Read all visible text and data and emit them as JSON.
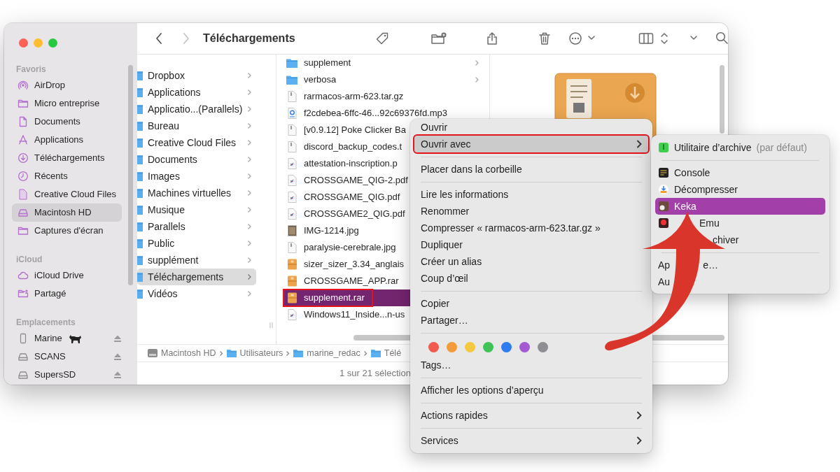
{
  "window": {
    "title": "Téléchargements"
  },
  "navigation": {
    "back_disabled": false,
    "forward_disabled": true
  },
  "sidebar": {
    "sections": [
      {
        "header": "Favoris",
        "items": [
          {
            "label": "AirDrop",
            "selected": false
          },
          {
            "label": "Micro entreprise",
            "selected": false
          },
          {
            "label": "Documents",
            "selected": false
          },
          {
            "label": "Applications",
            "selected": false
          },
          {
            "label": "Téléchargements",
            "selected": false
          },
          {
            "label": "Récents",
            "selected": false
          },
          {
            "label": "Creative Cloud Files",
            "selected": false
          },
          {
            "label": "Macintosh HD",
            "selected": true
          },
          {
            "label": "Captures d'écran",
            "selected": false
          }
        ]
      },
      {
        "header": "iCloud",
        "items": [
          {
            "label": "iCloud Drive",
            "selected": false
          },
          {
            "label": "Partagé",
            "selected": false
          }
        ]
      },
      {
        "header": "Emplacements",
        "items": [
          {
            "label": "Marine",
            "selected": false,
            "ejectable": true
          },
          {
            "label": "SCANS",
            "selected": false,
            "ejectable": true
          },
          {
            "label": "SupersSD",
            "selected": false,
            "ejectable": true
          }
        ]
      }
    ]
  },
  "column_1": [
    {
      "label": "Dropbox",
      "selected": false
    },
    {
      "label": "Applications",
      "selected": false
    },
    {
      "label": "Applicatio...(Parallels)",
      "selected": false
    },
    {
      "label": "Bureau",
      "selected": false
    },
    {
      "label": "Creative Cloud Files",
      "selected": false
    },
    {
      "label": "Documents",
      "selected": false
    },
    {
      "label": "Images",
      "selected": false
    },
    {
      "label": "Machines virtuelles",
      "selected": false
    },
    {
      "label": "Musique",
      "selected": false
    },
    {
      "label": "Parallels",
      "selected": false
    },
    {
      "label": "Public",
      "selected": false
    },
    {
      "label": "supplément",
      "selected": false
    },
    {
      "label": "Téléchargements",
      "selected": true
    },
    {
      "label": "Vidéos",
      "selected": false
    }
  ],
  "column_2": [
    {
      "label": "supplement",
      "kind": "folder",
      "selected": false
    },
    {
      "label": "verbosa",
      "kind": "folder",
      "selected": false
    },
    {
      "label": "rarmacos-arm-623.tar.gz",
      "kind": "document",
      "selected": false
    },
    {
      "label": "f2cdebea-6ffc-46...92c69376fd.mp3",
      "kind": "audio",
      "selected": false
    },
    {
      "label": "[v0.9.12] Poke Clicker Ba",
      "kind": "document",
      "selected": false
    },
    {
      "label": "discord_backup_codes.t",
      "kind": "document",
      "selected": false
    },
    {
      "label": "attestation-inscription.p",
      "kind": "pdf",
      "selected": false
    },
    {
      "label": "CROSSGAME_QIG-2.pdf",
      "kind": "pdf",
      "selected": false
    },
    {
      "label": "CROSSGAME_QIG.pdf",
      "kind": "pdf",
      "selected": false
    },
    {
      "label": "CROSSGAME2_QIG.pdf",
      "kind": "pdf",
      "selected": false
    },
    {
      "label": "IMG-1214.jpg",
      "kind": "image",
      "selected": false
    },
    {
      "label": "paralysie-cerebrale.jpg",
      "kind": "document",
      "selected": false
    },
    {
      "label": "sizer_sizer_3.34_anglais",
      "kind": "archive",
      "selected": false
    },
    {
      "label": "CROSSGAME_APP.rar",
      "kind": "archive",
      "selected": false
    },
    {
      "label": "supplement.rar",
      "kind": "archive",
      "selected": true,
      "annotated": true
    },
    {
      "label": "Windows11_Inside...n-us",
      "kind": "pdf",
      "selected": false
    }
  ],
  "path_bar": [
    "Macintosh HD",
    "Utilisateurs",
    "marine_redac",
    "Télé"
  ],
  "status_bar": "1 sur 21 sélection",
  "context_menu": [
    {
      "kind": "item",
      "label": "Ouvrir",
      "selected": false
    },
    {
      "kind": "item",
      "label": "Ouvrir avec",
      "selected": true,
      "submenu": true,
      "annotated": true
    },
    {
      "kind": "separator"
    },
    {
      "kind": "item",
      "label": "Placer dans la corbeille",
      "selected": false
    },
    {
      "kind": "separator"
    },
    {
      "kind": "item",
      "label": "Lire les informations",
      "selected": false
    },
    {
      "kind": "item",
      "label": "Renommer",
      "selected": false
    },
    {
      "kind": "item",
      "label": "Compresser « rarmacos-arm-623.tar.gz »",
      "selected": false
    },
    {
      "kind": "item",
      "label": "Dupliquer",
      "selected": false
    },
    {
      "kind": "item",
      "label": "Créer un alias",
      "selected": false
    },
    {
      "kind": "item",
      "label": "Coup d’œil",
      "selected": false
    },
    {
      "kind": "separator"
    },
    {
      "kind": "item",
      "label": "Copier",
      "selected": false
    },
    {
      "kind": "item",
      "label": "Partager…",
      "selected": false
    },
    {
      "kind": "separator"
    },
    {
      "kind": "tags",
      "tags": [
        {
          "color": "#f05a4f"
        },
        {
          "color": "#f39a3a"
        },
        {
          "color": "#f5c842"
        },
        {
          "color": "#3fc356"
        },
        {
          "color": "#2f7cf0"
        },
        {
          "color": "#a35ad1"
        },
        {
          "color": "#8e8e93"
        }
      ]
    },
    {
      "kind": "item",
      "label": "Tags…",
      "selected": false
    },
    {
      "kind": "separator"
    },
    {
      "kind": "item",
      "label": "Afficher les options d’aperçu",
      "selected": false
    },
    {
      "kind": "separator"
    },
    {
      "kind": "item",
      "label": "Actions rapides",
      "selected": false,
      "submenu": true
    },
    {
      "kind": "separator"
    },
    {
      "kind": "item",
      "label": "Services",
      "selected": false,
      "submenu": true
    }
  ],
  "submenu": [
    {
      "kind": "item",
      "label": "Utilitaire d’archive",
      "note": "(par défaut)",
      "selected": false
    },
    {
      "kind": "separator"
    },
    {
      "kind": "item",
      "label": "Console",
      "selected": false
    },
    {
      "kind": "item",
      "label": "Décompresser",
      "selected": false
    },
    {
      "kind": "item",
      "label": "Keka",
      "selected": true
    },
    {
      "kind": "partial",
      "parts": [
        "Emu"
      ],
      "selected": false
    },
    {
      "kind": "partial",
      "parts": [
        "chiver"
      ],
      "selected": false
    },
    {
      "kind": "separator"
    },
    {
      "kind": "partial",
      "parts": [
        "Ap",
        "e…"
      ],
      "selected": false
    },
    {
      "kind": "partial",
      "parts": [
        "Au"
      ],
      "selected": false
    }
  ]
}
